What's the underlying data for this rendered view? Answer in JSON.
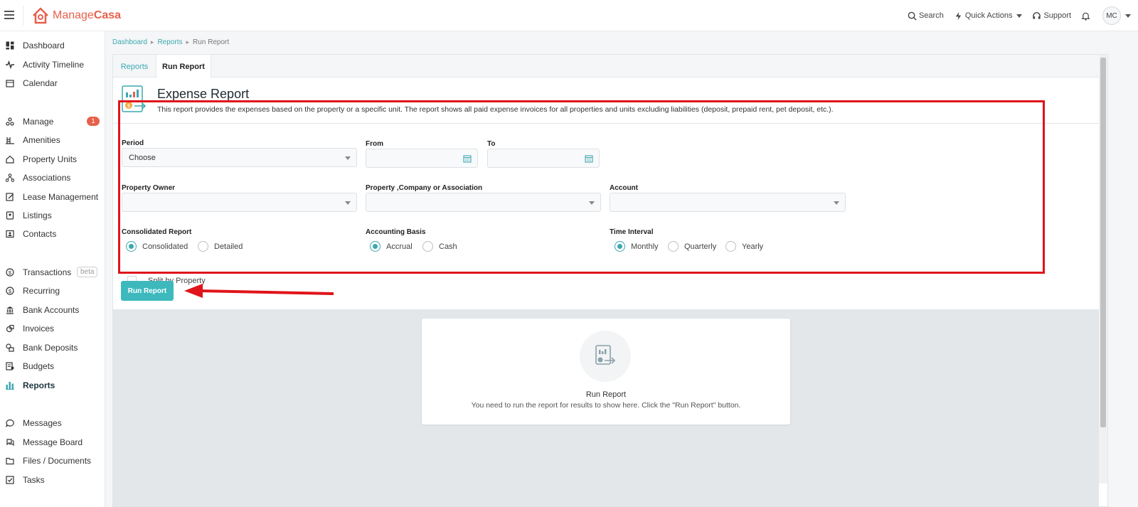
{
  "app": {
    "logo_part1": "Manage",
    "logo_part2": "Casa"
  },
  "topnav": {
    "search": "Search",
    "quick_actions": "Quick Actions",
    "support": "Support",
    "avatar": "MC"
  },
  "sidebar": {
    "items": [
      {
        "label": "Dashboard",
        "icon": "dashboard-icon"
      },
      {
        "label": "Activity Timeline",
        "icon": "activity-icon"
      },
      {
        "label": "Calendar",
        "icon": "calendar-icon"
      },
      {
        "label": "Manage",
        "icon": "manage-icon",
        "badge": "1"
      },
      {
        "label": "Amenities",
        "icon": "amenities-icon"
      },
      {
        "label": "Property Units",
        "icon": "home-icon"
      },
      {
        "label": "Associations",
        "icon": "associations-icon"
      },
      {
        "label": "Lease Management",
        "icon": "lease-icon"
      },
      {
        "label": "Listings",
        "icon": "listings-icon"
      },
      {
        "label": "Contacts",
        "icon": "contacts-icon"
      },
      {
        "label": "Transactions",
        "icon": "dollar-icon",
        "tag": "beta"
      },
      {
        "label": "Recurring",
        "icon": "recurring-icon"
      },
      {
        "label": "Bank Accounts",
        "icon": "bank-icon"
      },
      {
        "label": "Invoices",
        "icon": "invoice-icon"
      },
      {
        "label": "Bank Deposits",
        "icon": "deposit-icon"
      },
      {
        "label": "Budgets",
        "icon": "budget-icon"
      },
      {
        "label": "Reports",
        "icon": "reports-icon",
        "active": true
      },
      {
        "label": "Messages",
        "icon": "message-icon"
      },
      {
        "label": "Message Board",
        "icon": "board-icon"
      },
      {
        "label": "Files / Documents",
        "icon": "folder-icon"
      },
      {
        "label": "Tasks",
        "icon": "tasks-icon"
      }
    ]
  },
  "breadcrumb": {
    "b1": "Dashboard",
    "b2": "Reports",
    "b3": "Run Report"
  },
  "tabs": {
    "reports": "Reports",
    "run_report": "Run Report"
  },
  "report": {
    "title": "Expense Report",
    "description": "This report provides the expenses based on the property or a specific unit. The report shows all paid expense invoices for all properties and units excluding liabilities (deposit, prepaid rent, pet deposit, etc.)."
  },
  "form": {
    "period_label": "Period",
    "period_value": "Choose",
    "from_label": "From",
    "from_value": "",
    "to_label": "To",
    "to_value": "",
    "owner_label": "Property Owner",
    "owner_value": "",
    "property_label": "Property ,Company or Association",
    "property_value": "",
    "account_label": "Account",
    "account_value": "",
    "consolidated_label": "Consolidated Report",
    "consolidated_opt1": "Consolidated",
    "consolidated_opt2": "Detailed",
    "consolidated_selected": "Consolidated",
    "basis_label": "Accounting Basis",
    "basis_opt1": "Accrual",
    "basis_opt2": "Cash",
    "basis_selected": "Accrual",
    "interval_label": "Time Interval",
    "interval_opt1": "Monthly",
    "interval_opt2": "Quarterly",
    "interval_opt3": "Yearly",
    "interval_selected": "Monthly",
    "split_label": "Split by Property",
    "split_checked": false
  },
  "run_button": "Run Report",
  "empty": {
    "title": "Run Report",
    "subtitle": "You need to run the report for results to show here. Click the \"Run Report\" button."
  },
  "colors": {
    "accent": "#3db9bd",
    "brand": "#e8604c",
    "highlight": "#e0141b"
  }
}
